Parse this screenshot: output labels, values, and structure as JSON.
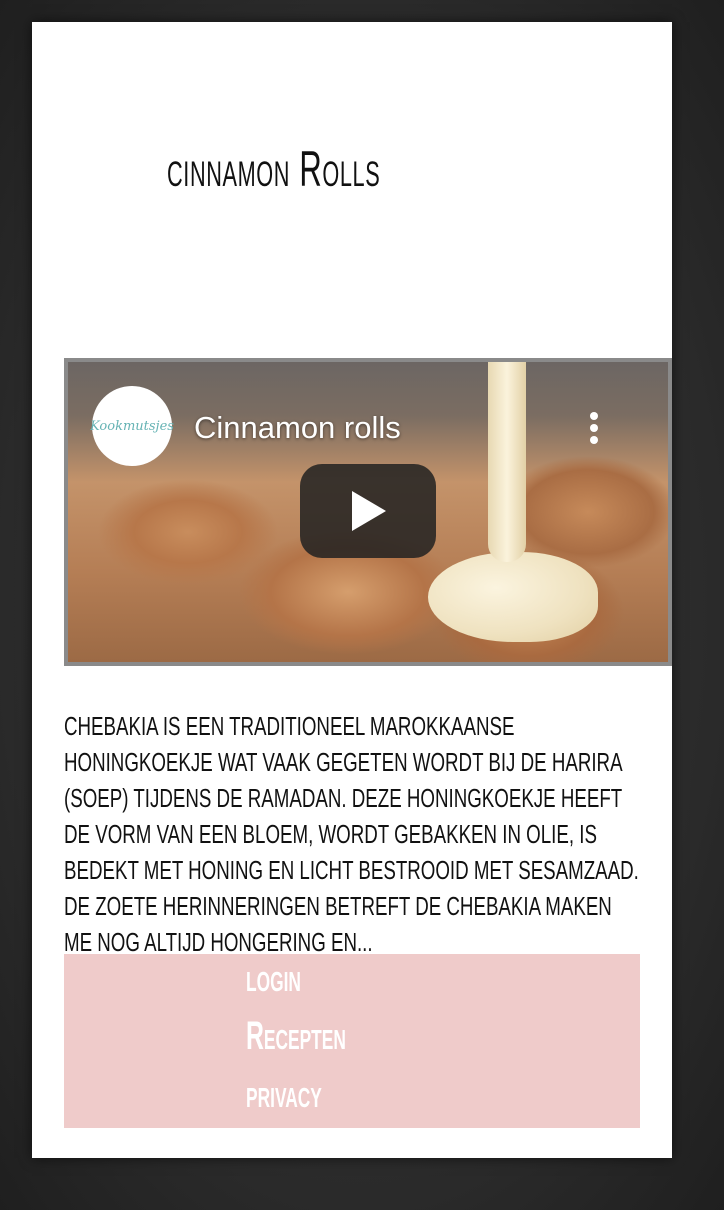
{
  "page": {
    "title": "cinnamon Rolls",
    "description": "Chebakia is een traditioneel Marokkaanse honingkoekje wat vaak gegeten wordt bij de harira (soep) tijdens de ramadan. Deze honingkoekje heeft de vorm van een bloem, wordt gebakken in olie, is bedekt met honing en licht bestrooid met sesamzaad. De zoete herinneringen betreft de chebakia maken me nog altijd hongering en..."
  },
  "video": {
    "title": "Cinnamon rolls",
    "channel_logo_text": "Kookmutsjes",
    "icons": {
      "menu": "more-vertical-icon",
      "play": "play-icon"
    }
  },
  "footer": {
    "links": [
      {
        "label": "login"
      },
      {
        "label": "Recepten"
      },
      {
        "label": "privacy"
      }
    ]
  },
  "colors": {
    "footer_bg": "#efcbca",
    "card_bg": "#ffffff",
    "backdrop": "#2a2a2a"
  }
}
